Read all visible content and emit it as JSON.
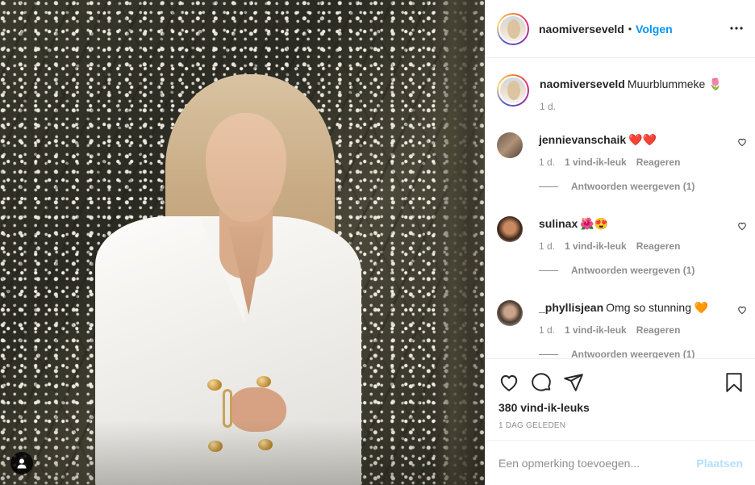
{
  "post": {
    "username": "naomiverseveld",
    "follow_label": "Volgen",
    "dot": "•",
    "likes": "380 vind-ik-leuks",
    "time_ago": "1 DAG GELEDEN"
  },
  "caption": {
    "username": "naomiverseveld",
    "text": "Muurblummeke 🌷",
    "time": "1 d."
  },
  "comments": [
    {
      "username": "jennievanschaik",
      "text": "❤️❤️",
      "time": "1 d.",
      "likes": "1 vind-ik-leuk",
      "reply": "Reageren",
      "view_replies": "Antwoorden weergeven (1)"
    },
    {
      "username": "sulinax",
      "text": "🌺😍",
      "time": "1 d.",
      "likes": "1 vind-ik-leuk",
      "reply": "Reageren",
      "view_replies": "Antwoorden weergeven (1)"
    },
    {
      "username": "_phyllisjean",
      "text": "Omg so stunning 🧡",
      "time": "1 d.",
      "likes": "1 vind-ik-leuk",
      "reply": "Reageren",
      "view_replies": "Antwoorden weergeven (1)"
    }
  ],
  "composer": {
    "placeholder": "Een opmerking toevoegen...",
    "post_label": "Plaatsen"
  },
  "icons": {
    "more": "more-options-icon",
    "like": "heart-icon",
    "comment": "comment-icon",
    "share": "share-icon",
    "save": "bookmark-icon",
    "user_tag": "user-tag-icon"
  },
  "colors": {
    "link": "#0095f6",
    "muted": "#8e8e8e",
    "post_disabled": "#b2dffc"
  }
}
